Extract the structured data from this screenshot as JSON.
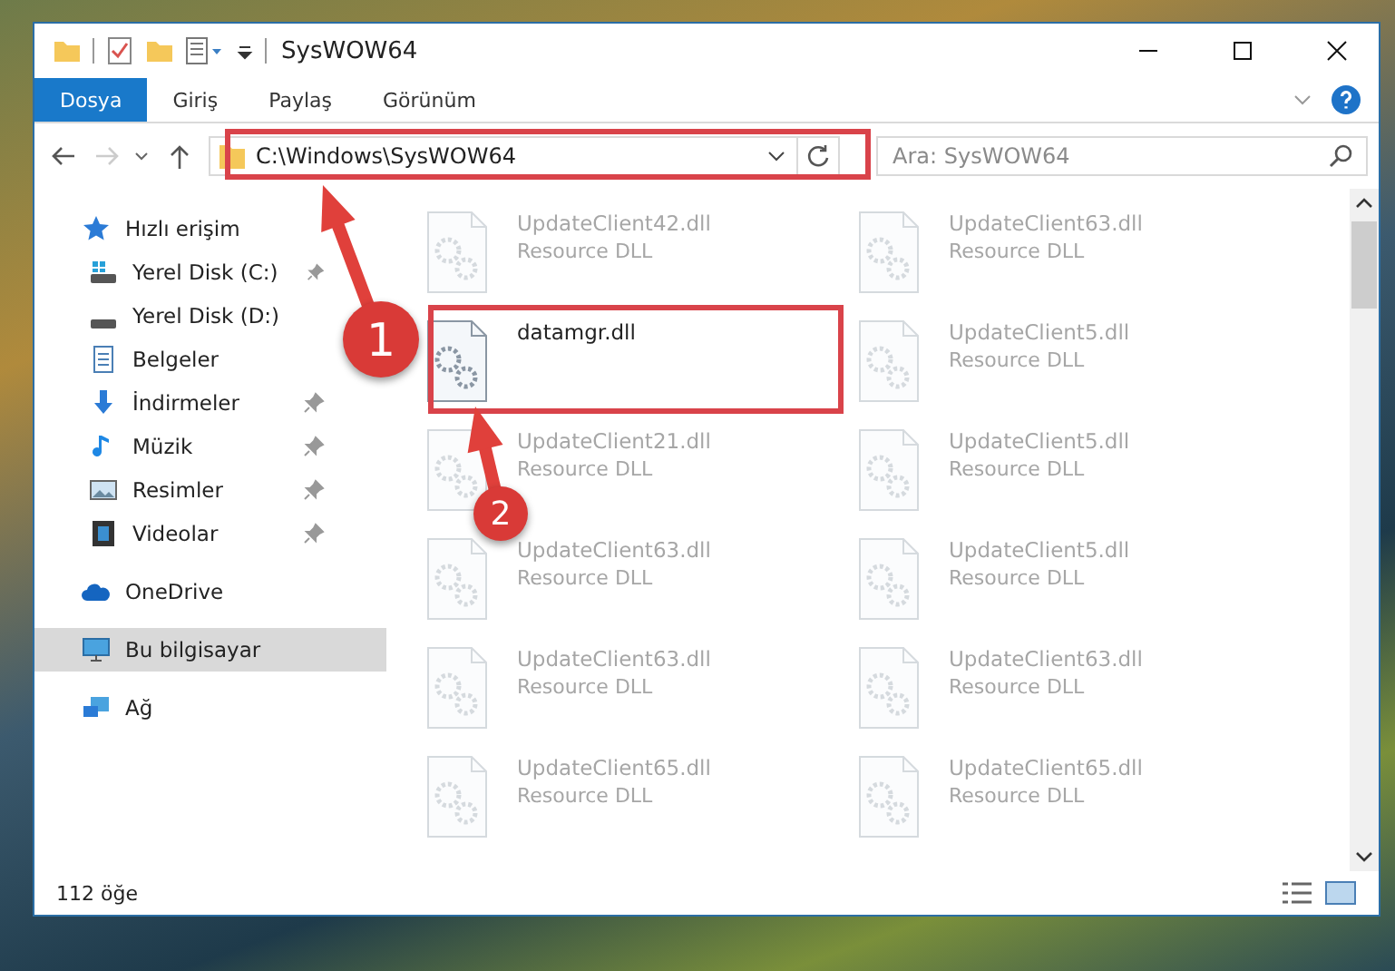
{
  "window": {
    "title": "SysWOW64"
  },
  "ribbon": {
    "tabs": [
      {
        "label": "Dosya",
        "selected": true
      },
      {
        "label": "Giriş",
        "selected": false
      },
      {
        "label": "Paylaş",
        "selected": false
      },
      {
        "label": "Görünüm",
        "selected": false
      }
    ]
  },
  "address_bar": {
    "path": "C:\\Windows\\SysWOW64",
    "forward_disabled": true
  },
  "search": {
    "placeholder": "Ara: SysWOW64"
  },
  "sidebar": {
    "items": [
      {
        "label": "Hızlı erişim",
        "kind": "star",
        "selected": false,
        "children": [
          {
            "label": "Yerel Disk (C:)",
            "kind": "drive-c",
            "pinned": true,
            "selected": false
          },
          {
            "label": "Yerel Disk (D:)",
            "kind": "drive",
            "pinned": false,
            "selected": false
          },
          {
            "label": "Belgeler",
            "kind": "docs",
            "pinned": false,
            "selected": false
          },
          {
            "label": "İndirmeler",
            "kind": "download",
            "pinned": true,
            "selected": false
          },
          {
            "label": "Müzik",
            "kind": "music",
            "pinned": true,
            "selected": false
          },
          {
            "label": "Resimler",
            "kind": "pictures",
            "pinned": true,
            "selected": false
          },
          {
            "label": "Videolar",
            "kind": "video",
            "pinned": true,
            "selected": false
          }
        ]
      },
      {
        "label": "OneDrive",
        "kind": "cloud",
        "selected": false
      },
      {
        "label": "Bu bilgisayar",
        "kind": "pc",
        "selected": true
      },
      {
        "label": "Ağ",
        "kind": "network",
        "selected": false
      }
    ]
  },
  "files": [
    {
      "name": "UpdateClient42.dll",
      "type": "Resource DLL",
      "dimmed": true
    },
    {
      "name": "UpdateClient63.dll",
      "type": "Resource DLL",
      "dimmed": true
    },
    {
      "name": "datamgr.dll",
      "dimmed": false
    },
    {
      "name": "UpdateClient5.dll",
      "type": "Resource DLL",
      "dimmed": true
    },
    {
      "name": "UpdateClient21.dll",
      "type": "Resource DLL",
      "dimmed": true
    },
    {
      "name": "UpdateClient5.dll",
      "type": "Resource DLL",
      "dimmed": true
    },
    {
      "name": "UpdateClient63.dll",
      "type": "Resource DLL",
      "dimmed": true
    },
    {
      "name": "UpdateClient5.dll",
      "type": "Resource DLL",
      "dimmed": true
    },
    {
      "name": "UpdateClient63.dll",
      "type": "Resource DLL",
      "dimmed": true
    },
    {
      "name": "UpdateClient63.dll",
      "type": "Resource DLL",
      "dimmed": true
    },
    {
      "name": "UpdateClient65.dll",
      "type": "Resource DLL",
      "dimmed": true
    },
    {
      "name": "UpdateClient65.dll",
      "type": "Resource DLL",
      "dimmed": true
    }
  ],
  "status_bar": {
    "count": "112 öğe"
  },
  "annotations": [
    {
      "number": "1"
    },
    {
      "number": "2"
    }
  ]
}
